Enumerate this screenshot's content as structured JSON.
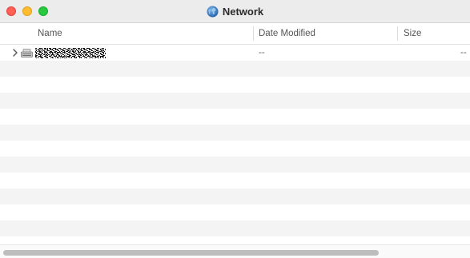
{
  "window": {
    "title": "Network",
    "title_icon": "globe-icon"
  },
  "columns": {
    "name": "Name",
    "date_modified": "Date Modified",
    "size": "Size"
  },
  "rows": [
    {
      "icon": "network-drive-icon",
      "name_redacted": true,
      "date_modified": "--",
      "size": "--"
    }
  ],
  "colors": {
    "close": "#fe5f57",
    "minimize": "#febc2e",
    "zoom": "#28c840",
    "stripe": "#f4f4f5"
  }
}
